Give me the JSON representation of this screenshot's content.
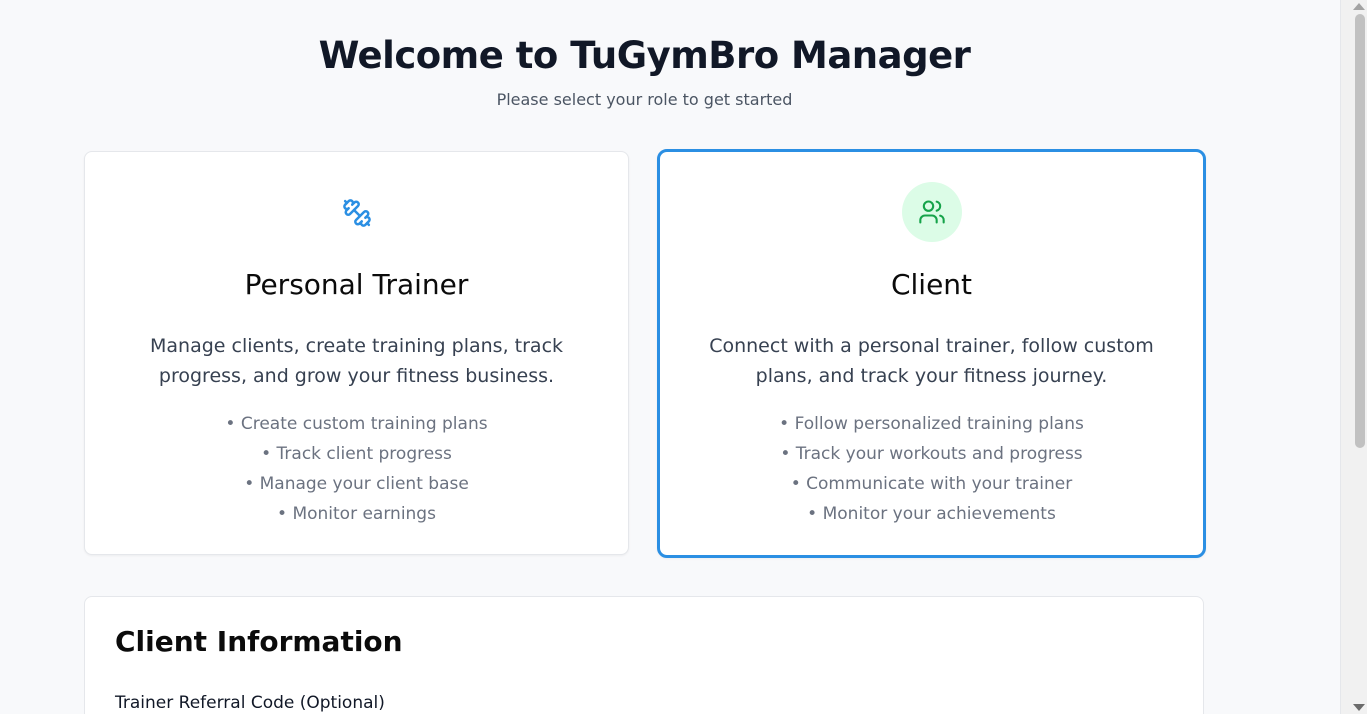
{
  "header": {
    "title": "Welcome to TuGymBro Manager",
    "subtitle": "Please select your role to get started"
  },
  "roles": [
    {
      "icon": "dumbbell-icon",
      "title": "Personal Trainer",
      "description": "Manage clients, create training plans, track progress, and grow your fitness business.",
      "features": [
        "• Create custom training plans",
        "• Track client progress",
        "• Manage your client base",
        "• Monitor earnings"
      ],
      "selected": false
    },
    {
      "icon": "users-icon",
      "title": "Client",
      "description": "Connect with a personal trainer, follow custom plans, and track your fitness journey.",
      "features": [
        "• Follow personalized training plans",
        "• Track your workouts and progress",
        "• Communicate with your trainer",
        "• Monitor your achievements"
      ],
      "selected": true
    }
  ],
  "client_info": {
    "title": "Client Information",
    "referral_label": "Trainer Referral Code (Optional)"
  },
  "colors": {
    "accent_blue": "#2b8fe3",
    "client_icon_bg": "#dcfce7",
    "client_icon": "#16a34a",
    "trainer_icon": "#2b8fe3"
  }
}
